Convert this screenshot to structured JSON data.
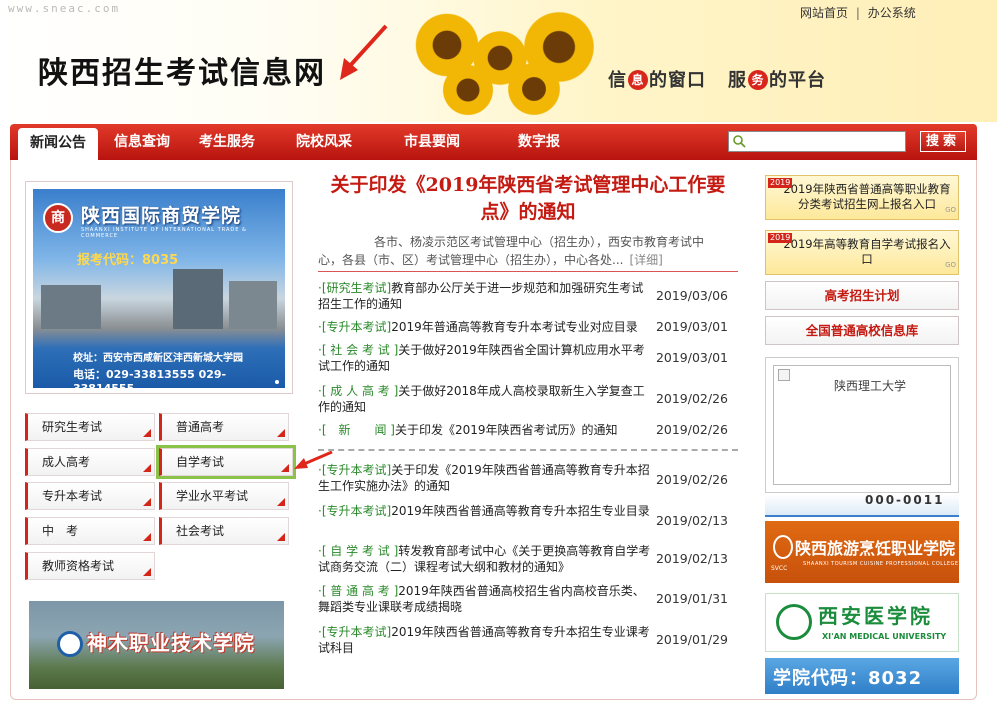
{
  "header": {
    "domain": "www.sneac.com",
    "toplinks": [
      "网站首页",
      "办公系统"
    ],
    "toplinks_sep": "|",
    "site_title": "陕西招生考试信息网",
    "slogan": {
      "a": "信",
      "a_dot": "息",
      "b": "的窗口",
      "c": "服",
      "c_dot": "务",
      "d": "的平台"
    }
  },
  "nav": {
    "items": [
      "新闻公告",
      "信息查询",
      "考生服务",
      "院校风采",
      "市县要闻",
      "数字报"
    ],
    "active": 0,
    "search_placeholder": "",
    "search_button": "搜索"
  },
  "left": {
    "promo1": {
      "seal": "商",
      "school_name": "陕西国际商贸学院",
      "school_en": "SHAANXI INSTITUTE OF INTERNATIONAL TRADE & COMMERCE",
      "code": "报考代码：8035",
      "address": "校址：西安市西咸新区沣西新城大学园",
      "tel": "电话：029-33813555  029-33814555"
    },
    "categories": [
      {
        "label": "研究生考试"
      },
      {
        "label": "普通高考"
      },
      {
        "label": "成人高考"
      },
      {
        "label": "自学考试"
      },
      {
        "label": "专升本考试"
      },
      {
        "label": "学业水平考试"
      },
      {
        "label": "中　考"
      },
      {
        "label": "社会考试"
      },
      {
        "label": "教师资格考试"
      }
    ],
    "promo2": {
      "school_name": "神木职业技术学院"
    }
  },
  "main": {
    "headline": "关于印发《2019年陕西省考试管理中心工作要点》的通知",
    "summary": "各市、杨凌示范区考试管理中心（招生办），西安市教育考试中心，各县（市、区）考试管理中心（招生办），中心各处...",
    "detail_link": "[详细]",
    "news_group1": [
      {
        "tag": "·[研究生考试]",
        "title": "教育部办公厅关于进一步规范和加强研究生考试招生工作的通知",
        "date": "2019/03/06"
      },
      {
        "tag": "·[专升本考试]",
        "title": "2019年普通高等教育专升本考试专业对应目录",
        "date": "2019/03/01"
      },
      {
        "tag": "·[ 社 会 考 试 ]",
        "title": "关于做好2019年陕西省全国计算机应用水平考试工作的通知",
        "date": "2019/03/01"
      },
      {
        "tag": "·[ 成 人 高 考 ]",
        "title": "关于做好2018年成人高校录取新生入学复查工作的通知",
        "date": "2019/02/26"
      },
      {
        "tag": "·[　新　　闻 ]",
        "title": "关于印发《2019年陕西省考试历》的通知",
        "date": "2019/02/26"
      }
    ],
    "news_group2": [
      {
        "tag": "·[专升本考试]",
        "title": "关于印发《2019年陕西省普通高等教育专升本招生工作实施办法》的通知",
        "date": "2019/02/26"
      },
      {
        "tag": "·[专升本考试]",
        "title": "2019年陕西省普通高等教育专升本招生专业目录",
        "date": "2019/02/13"
      },
      {
        "tag": "·[ 自 学 考 试 ]",
        "title": "转发教育部考试中心《关于更换高等教育自学考试商务交流（二）课程考试大纲和教材的通知》",
        "date": "2019/02/13"
      },
      {
        "tag": "·[ 普 通 高 考 ]",
        "title": "2019年陕西省普通高校招生省内高校音乐类、舞蹈类专业课联考成绩揭晓",
        "date": "2019/01/31"
      },
      {
        "tag": "·[专升本考试]",
        "title": "2019年陕西省普通高等教育专升本招生专业课考试科目",
        "date": "2019/01/29"
      }
    ]
  },
  "right": {
    "yellow1": {
      "year": "2019",
      "text": "2019年陕西省普通高等职业教育分类考试招生网上报名入口",
      "go": "GO"
    },
    "yellow2": {
      "year": "2019",
      "text": "2019年高等教育自学考试报名入口",
      "go": "GO"
    },
    "links": [
      "高考招生计划",
      "全国普通高校信息库"
    ],
    "image_alt": "陕西理工大学",
    "strip_text": "000-0011",
    "ad1": {
      "name": "陕西旅游烹饪职业学院",
      "en": "SHAANXI TOURISM CUISINE PROFESSIONAL COLLEGE",
      "logo": "SVCC"
    },
    "ad2": {
      "name": "西安医学院",
      "en": "XI'AN MEDICAL UNIVERSITY"
    },
    "ad3": {
      "text": "学院代码：8032"
    }
  },
  "colors": {
    "brand_red": "#c41a12",
    "nav_red": "#d4251a",
    "tag_green": "#2b8a2b",
    "highlight_green": "#8bc34a"
  }
}
